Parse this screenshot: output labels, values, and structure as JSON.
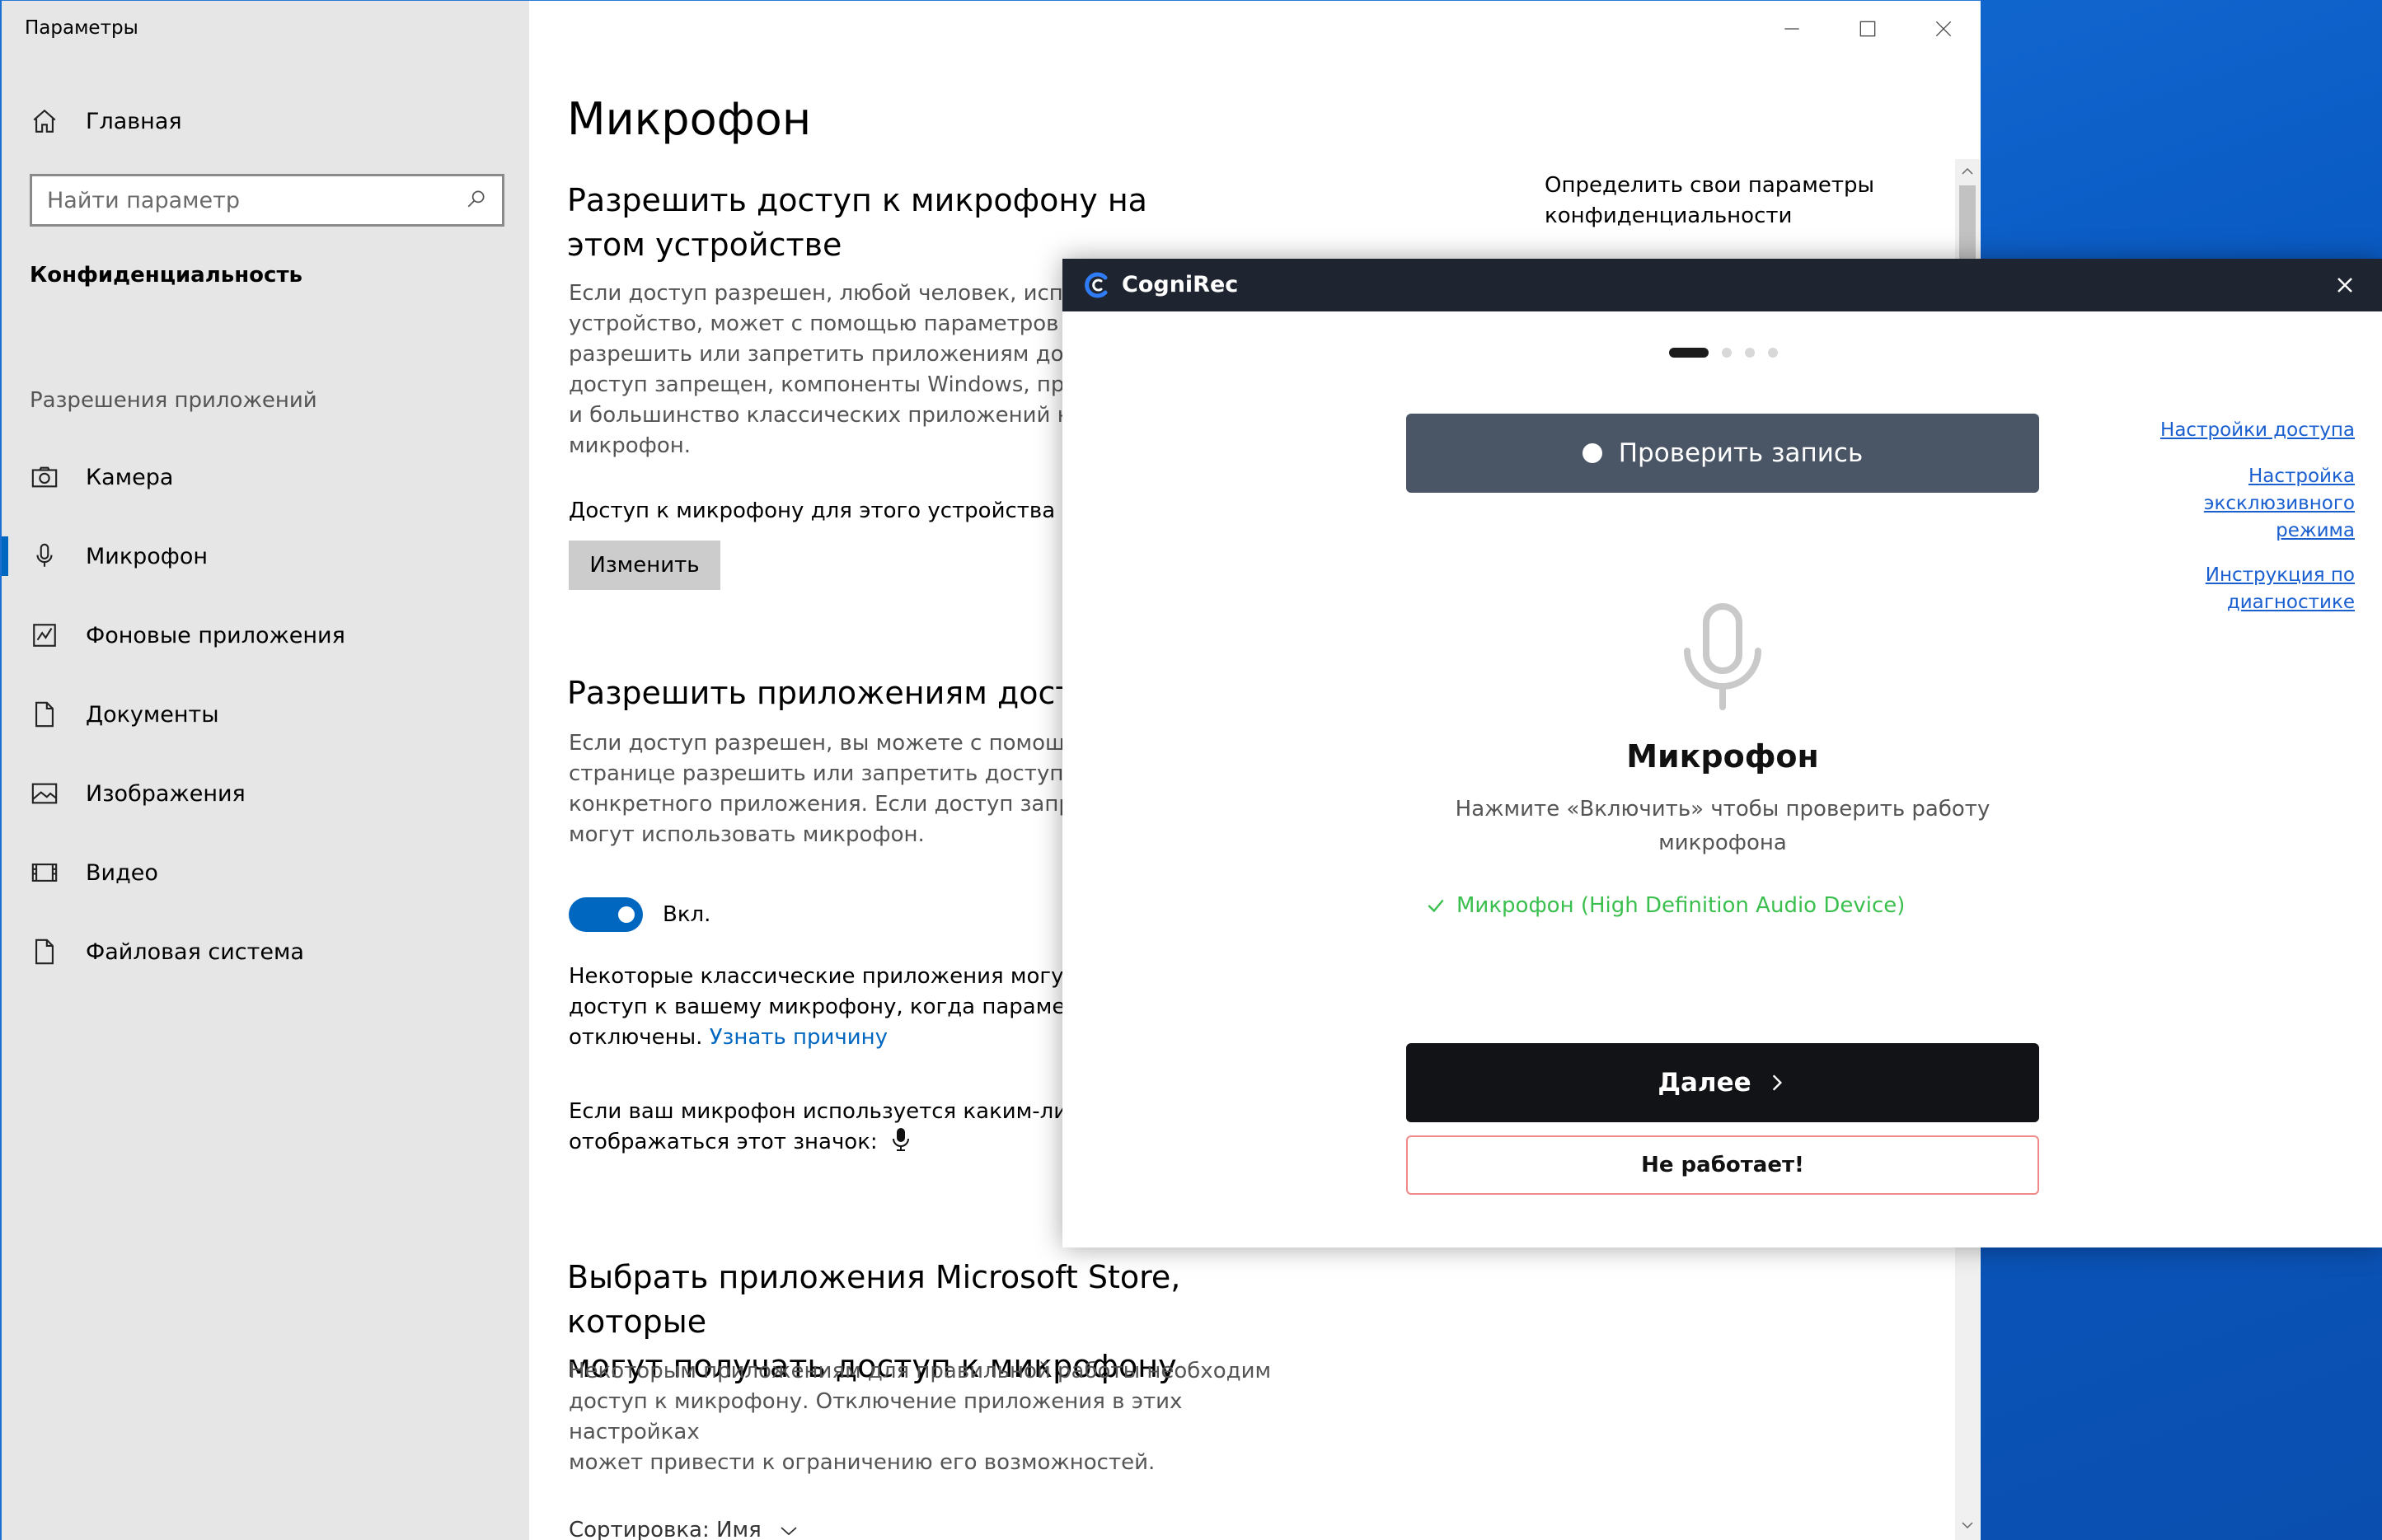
{
  "settings": {
    "window_title": "Параметры",
    "search_placeholder": "Найти параметр",
    "nav_home": "Главная",
    "section": "Конфиденциальность",
    "group": "Разрешения приложений",
    "nav_items": [
      {
        "label": "Камера",
        "icon": "camera-icon"
      },
      {
        "label": "Микрофон",
        "icon": "microphone-icon"
      },
      {
        "label": "Фоновые приложения",
        "icon": "background-apps-icon"
      },
      {
        "label": "Документы",
        "icon": "document-icon"
      },
      {
        "label": "Изображения",
        "icon": "image-icon"
      },
      {
        "label": "Видео",
        "icon": "video-icon"
      },
      {
        "label": "Файловая система",
        "icon": "file-icon"
      }
    ],
    "selected_item": "Микрофон",
    "page_title": "Микрофон",
    "h1": "Разрешить доступ к микрофону на этом устройстве",
    "p1": "Если доступ разрешен, любой человек, использ... устройство, может с помощью параметров на... разрешить или запретить приложениям досту... доступ запрещен, компоненты Windows, прило... и большинство классических приложений не м... микрофон.",
    "p1_lines": [
      "Если доступ разрешен, любой человек, испол",
      "устройство, может с помощью параметров на",
      "разрешить или запретить приложениям досту",
      "доступ запрещен, компоненты Windows, прило",
      "и большинство классических приложений не м",
      "микрофон."
    ],
    "device_access": "Доступ к микрофону для этого устройства вкл",
    "change_button": "Изменить",
    "h2": "Разрешить приложениям доступ",
    "p2_lines": [
      "Если доступ разрешен, вы можете с помощью",
      "странице разрешить или запретить доступ к м",
      "конкретного приложения. Если доступ запреш",
      "могут использовать микрофон."
    ],
    "toggle_label": "Вкл.",
    "toggle_on": true,
    "p3_lines": [
      "Некоторые классические приложения могут п",
      "доступ к вашему микрофону, когда параметры"
    ],
    "p3_last": "отключены.",
    "p3_link": "Узнать причину",
    "p4_lines": [
      "Если ваш микрофон используется каким-либо",
      "отображаться этот значок:"
    ],
    "h3_lines": [
      "Выбрать приложения Microsoft Store, которые",
      "могут получать доступ к микрофону"
    ],
    "p5_lines": [
      "Некоторым приложениям для правильной работы необходим",
      "доступ к микрофону. Отключение приложения в этих настройках",
      "может привести к ограничению его возможностей."
    ],
    "sort_label": "Сортировка: Имя",
    "right_panel_lines": [
      "Определить свои параметры",
      "конфиденциальности"
    ]
  },
  "popup": {
    "title": "CogniRec",
    "steps_total": 4,
    "step_current": 1,
    "record_button": "Проверить запись",
    "links": [
      [
        "Настройки доступа"
      ],
      [
        "Настройка",
        "эксклюзивного",
        "режима"
      ],
      [
        "Инструкция по",
        "диагностике"
      ]
    ],
    "mic_title": "Микрофон",
    "mic_sub_lines": [
      "Нажмите «Включить» чтобы проверить работу",
      "микрофона"
    ],
    "device_status": "Микрофон (High Definition Audio Device)",
    "next_button": "Далее",
    "fail_button": "Не работает!",
    "colors": {
      "bar": "#1f2530",
      "record_btn": "#4a5566",
      "next_btn": "#121316",
      "ok_green": "#3bbf4f",
      "fail_border": "#f08a8a",
      "link": "#1a5fd0"
    }
  }
}
